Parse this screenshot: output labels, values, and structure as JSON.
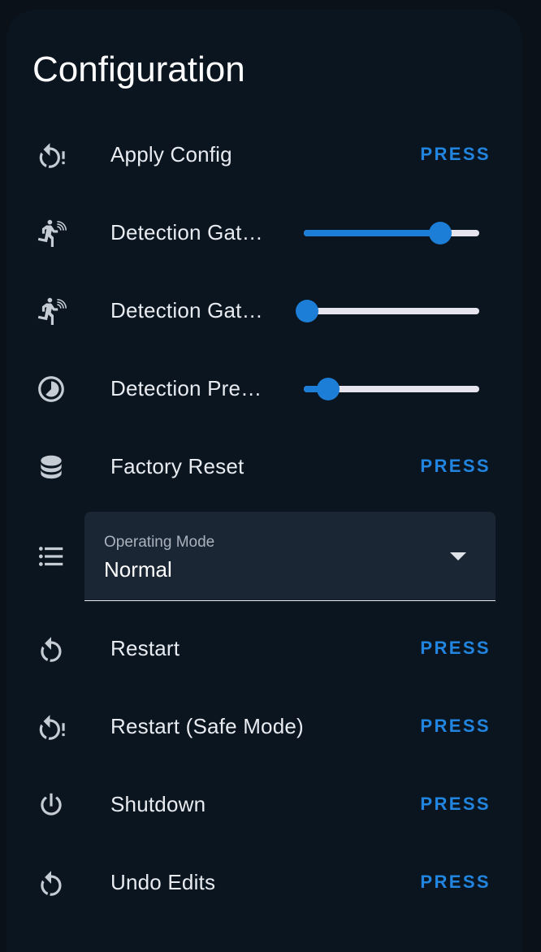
{
  "card": {
    "title": "Configuration"
  },
  "rows": [
    {
      "icon": "restart-alert-icon",
      "label": "Apply Config",
      "action": "PRESS"
    },
    {
      "icon": "motion-sensor-icon",
      "label": "Detection Gate Max",
      "slider_fraction": 0.78
    },
    {
      "icon": "motion-sensor-icon",
      "label": "Detection Gate Min",
      "slider_fraction": 0.02
    },
    {
      "icon": "timelapse-icon",
      "label": "Detection Presence Timeout",
      "slider_fraction": 0.14
    },
    {
      "icon": "database-icon",
      "label": "Factory Reset",
      "action": "PRESS"
    },
    {
      "icon": "restart-icon",
      "label": "Restart",
      "action": "PRESS"
    },
    {
      "icon": "restart-alert-icon",
      "label": "Restart (Safe Mode)",
      "action": "PRESS"
    },
    {
      "icon": "power-icon",
      "label": "Shutdown",
      "action": "PRESS"
    },
    {
      "icon": "restart-icon",
      "label": "Undo Edits",
      "action": "PRESS"
    }
  ],
  "select": {
    "icon": "list-icon",
    "label": "Operating Mode",
    "value": "Normal"
  },
  "colors": {
    "accent": "#1c7ed6",
    "background": "#0b1520",
    "field": "#1b2634"
  }
}
